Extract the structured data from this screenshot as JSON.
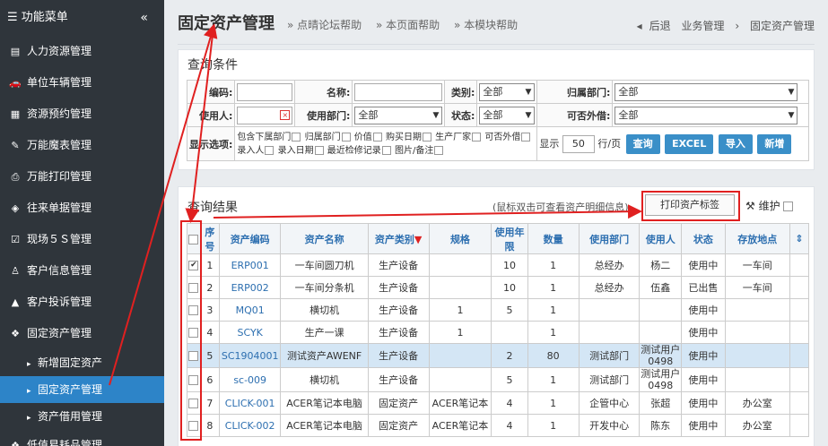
{
  "sidebar": {
    "title": "功能菜单",
    "items": [
      {
        "label": "人力资源管理",
        "icon": "id-card-icon",
        "glyph": "▤"
      },
      {
        "label": "单位车辆管理",
        "icon": "car-icon",
        "glyph": "🚗"
      },
      {
        "label": "资源预约管理",
        "icon": "grid-icon",
        "glyph": "▦"
      },
      {
        "label": "万能魔表管理",
        "icon": "wand-icon",
        "glyph": "✎"
      },
      {
        "label": "万能打印管理",
        "icon": "printer-icon",
        "glyph": "⎙"
      },
      {
        "label": "往来单据管理",
        "icon": "tag-icon",
        "glyph": "◈"
      },
      {
        "label": "现场５Ｓ管理",
        "icon": "checkbox-icon",
        "glyph": "☑"
      },
      {
        "label": "客户信息管理",
        "icon": "user-icon",
        "glyph": "♙"
      },
      {
        "label": "客户投诉管理",
        "icon": "warning-icon",
        "glyph": "▲"
      },
      {
        "label": "固定资产管理",
        "icon": "cubes-icon",
        "glyph": "❖"
      }
    ],
    "sub": [
      "新增固定资产",
      "固定资产管理",
      "资产借用管理"
    ],
    "last": "低值易耗品管理"
  },
  "header": {
    "title": "固定资产管理",
    "helps": [
      "» 点晴论坛帮助",
      "» 本页面帮助",
      "» 本模块帮助"
    ],
    "back": "后退",
    "bc1": "业务管理",
    "bc2": "固定资产管理"
  },
  "cond": {
    "title": "查询条件",
    "l_code": "编码:",
    "l_name": "名称:",
    "l_type": "类别:",
    "l_dept": "归属部门:",
    "l_user": "使用人:",
    "l_udept": "使用部门:",
    "l_state": "状态:",
    "l_lend": "可否外借:",
    "all": "全部",
    "l_opt": "显示选项:",
    "opts": [
      "包含下属部门",
      "归属部门",
      "价值",
      "购买日期",
      "生产厂家",
      "可否外借",
      "录入人",
      "录入日期",
      "最近检修记录",
      "图片/备注"
    ],
    "show": "显示",
    "rows": "50",
    "perpage": "行/页",
    "b_query": "查询",
    "b_excel": "EXCEL",
    "b_import": "导入",
    "b_add": "新增"
  },
  "result": {
    "title": "查询结果",
    "hint": "(鼠标双击可查看资产明细信息)",
    "print": "打印资产标签",
    "maint": "维护",
    "headers": [
      "序号",
      "资产编码",
      "资产名称",
      "资产类别",
      "规格",
      "使用年限",
      "数量",
      "使用部门",
      "使用人",
      "状态",
      "存放地点"
    ],
    "rows": [
      [
        "1",
        "ERP001",
        "一车间圆刀机",
        "生产设备",
        "",
        "10",
        "1",
        "总经办",
        "杨二",
        "使用中",
        "一车间"
      ],
      [
        "2",
        "ERP002",
        "一车间分条机",
        "生产设备",
        "",
        "10",
        "1",
        "总经办",
        "伍鑫",
        "已出售",
        "一车间"
      ],
      [
        "3",
        "MQ01",
        "横切机",
        "生产设备",
        "1",
        "5",
        "1",
        "",
        "",
        "使用中",
        ""
      ],
      [
        "4",
        "SCYK",
        "生产一课",
        "生产设备",
        "1",
        "",
        "1",
        "",
        "",
        "使用中",
        ""
      ],
      [
        "5",
        "SC1904001",
        "测试资产AWENF",
        "生产设备",
        "",
        "2",
        "80",
        "测试部门",
        "测试用户0498",
        "使用中",
        ""
      ],
      [
        "6",
        "sc-009",
        "横切机",
        "生产设备",
        "",
        "5",
        "1",
        "测试部门",
        "测试用户0498",
        "使用中",
        ""
      ],
      [
        "7",
        "CLICK-001",
        "ACER笔记本电脑",
        "固定资产",
        "ACER笔记本",
        "4",
        "1",
        "企管中心",
        "张超",
        "使用中",
        "办公室"
      ],
      [
        "8",
        "CLICK-002",
        "ACER笔记本电脑",
        "固定资产",
        "ACER笔记本",
        "4",
        "1",
        "开发中心",
        "陈东",
        "使用中",
        "办公室"
      ]
    ]
  }
}
